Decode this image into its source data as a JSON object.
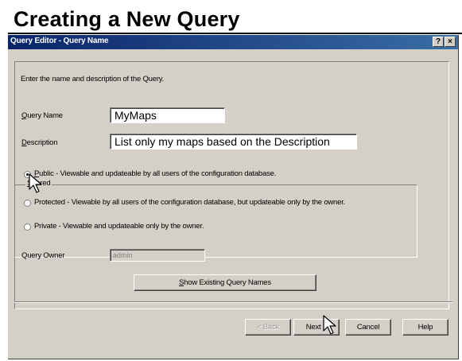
{
  "slide": {
    "title": "Creating a New Query"
  },
  "dialog": {
    "title": "Query Editor - Query Name",
    "help_glyph": "?",
    "close_glyph": "×",
    "instruction": "Enter the name and description of the Query.",
    "query_name": {
      "label_ul": "Q",
      "label_rest": "uery Name",
      "value": "MyMaps"
    },
    "description": {
      "label_ul": "D",
      "label_rest": "escription",
      "value": "List only my maps based on the Description"
    },
    "shared": {
      "legend_ul": "S",
      "legend_rest": "hared",
      "options": [
        {
          "label_ul": "P",
          "label_rest": "ublic - Viewable and updateable by all users of the configuration database.",
          "checked": true
        },
        {
          "label_ul": "",
          "label_rest": "Protected - Viewable by all users of the configuration database, but updateable only by the owner.",
          "checked": false
        },
        {
          "label_ul": "",
          "label_rest": "Private - Viewable and updateable only by the owner.",
          "checked": false
        }
      ]
    },
    "owner": {
      "label": "Query Owner",
      "value": "admin"
    },
    "show_names_button": {
      "label_ul": "S",
      "label_rest": "how Existing Query Names"
    },
    "buttons": {
      "back": "< Back",
      "next": "Next >",
      "cancel": "Cancel",
      "help": "Help"
    }
  }
}
